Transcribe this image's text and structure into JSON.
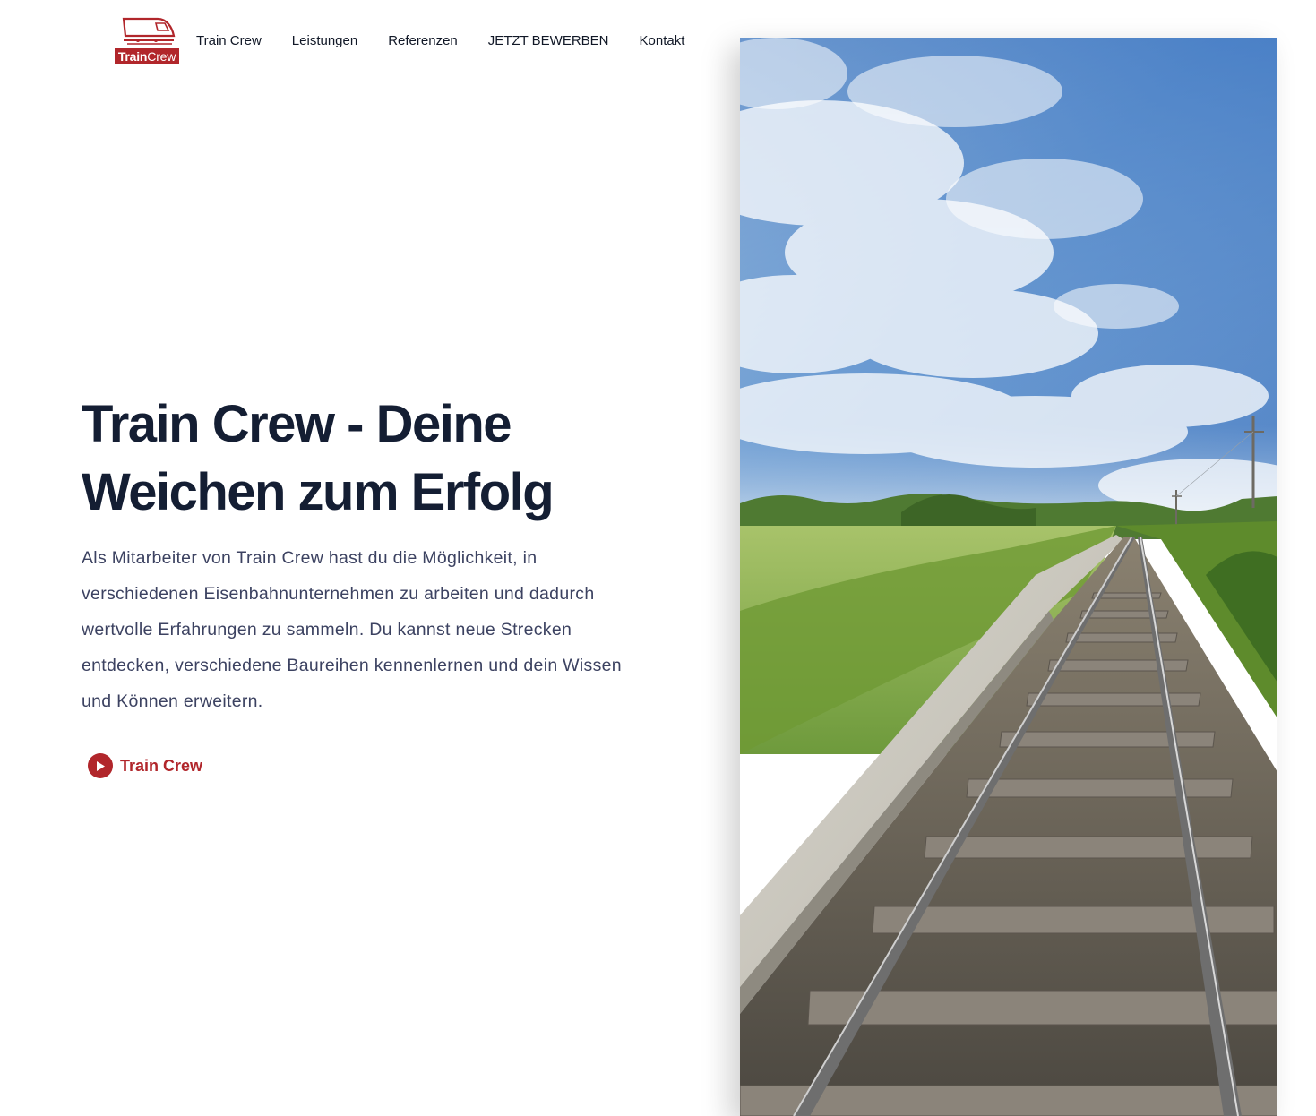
{
  "brand": {
    "logo_text_bold": "Train",
    "logo_text_light": "Crew",
    "accent_color": "#b1262b"
  },
  "nav": {
    "items": [
      {
        "label": "Train Crew"
      },
      {
        "label": "Leistungen"
      },
      {
        "label": "Referenzen"
      },
      {
        "label": "JETZT BEWERBEN"
      },
      {
        "label": "Kontakt"
      }
    ]
  },
  "hero": {
    "title_line1": "Train Crew - Deine",
    "title_line2": "Weichen zum Erfolg",
    "description": "Als Mitarbeiter von Train Crew hast du die Möglichkeit, in verschiedenen Eisenbahnunternehmen zu arbeiten und dadurch wertvolle Erfahrungen zu sammeln. Du kannst neue Strecken entdecken, verschiedene Baureihen kennenlernen und dein Wissen und Können erweitern.",
    "cta_label": "Train Crew",
    "cta_icon": "play-circle-icon"
  },
  "image": {
    "subject": "railway-track-through-green-fields-under-blue-sky"
  }
}
